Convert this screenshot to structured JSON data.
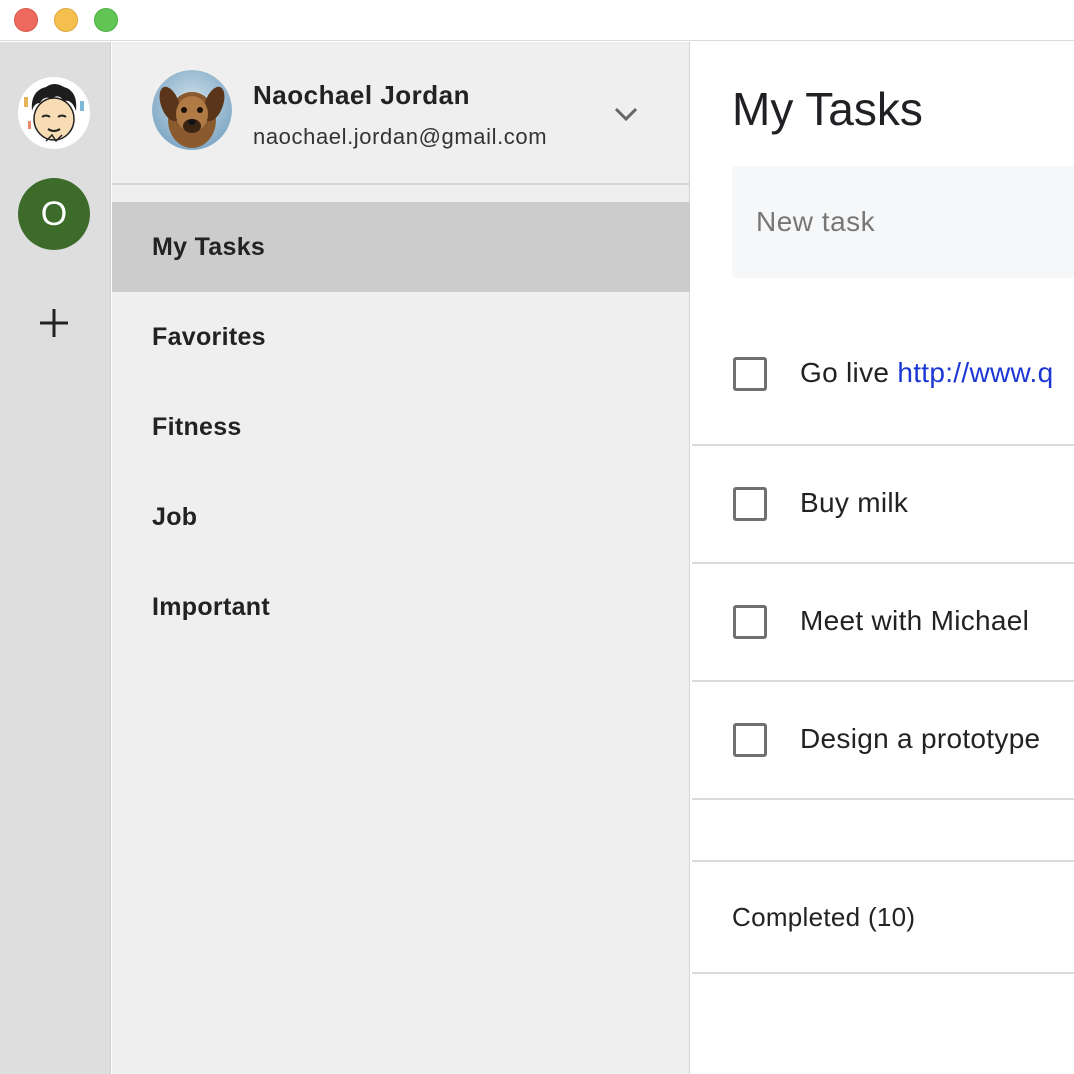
{
  "account": {
    "name": "Naochael Jordan",
    "email": "naochael.jordan@gmail.com"
  },
  "rail": {
    "account_initial": "O"
  },
  "sidebar": {
    "items": [
      {
        "label": "My Tasks",
        "active": true
      },
      {
        "label": "Favorites",
        "active": false
      },
      {
        "label": "Fitness",
        "active": false
      },
      {
        "label": "Job",
        "active": false
      },
      {
        "label": "Important",
        "active": false
      }
    ]
  },
  "main": {
    "title": "My Tasks",
    "new_task_placeholder": "New task",
    "tasks": [
      {
        "text": "Go live ",
        "link": "http://www.q",
        "checked": false
      },
      {
        "text": "Buy milk",
        "checked": false
      },
      {
        "text": "Meet with Michael",
        "checked": false
      },
      {
        "text": "Design a prototype",
        "checked": false
      }
    ],
    "completed_label": "Completed (10)"
  },
  "colors": {
    "active_item_bg": "#cccccc",
    "rail_bg": "#dedede",
    "sidebar_bg": "#efefef",
    "account_badge": "#3d6b2a",
    "link": "#1a36d4"
  },
  "icons": [
    "user-avatar-icon",
    "plus-icon",
    "chevron-down-icon",
    "checkbox-icon"
  ]
}
